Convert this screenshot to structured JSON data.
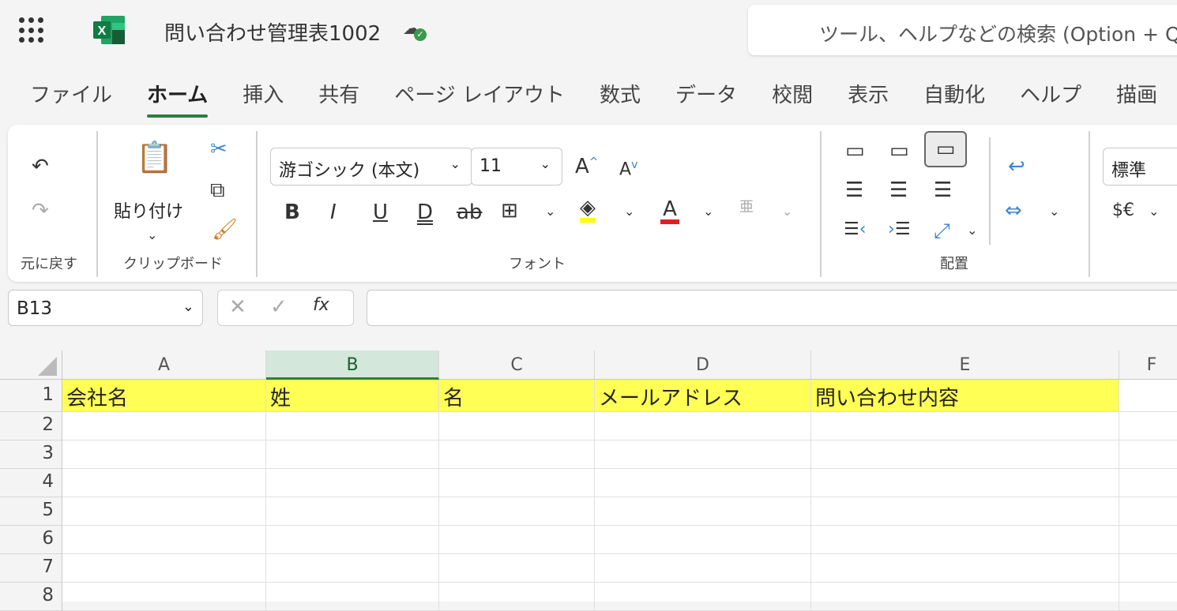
{
  "app": {
    "title": "問い合わせ管理表1002",
    "search_placeholder": "ツール、ヘルプなどの検索 (Option + Q)"
  },
  "tabs": [
    "ファイル",
    "ホーム",
    "挿入",
    "共有",
    "ページ レイアウト",
    "数式",
    "データ",
    "校閲",
    "表示",
    "自動化",
    "ヘルプ",
    "描画"
  ],
  "active_tab": "ホーム",
  "ribbon": {
    "undo_group": "元に戻す",
    "clipboard_group": "クリップボード",
    "paste_label": "貼り付け",
    "font_group": "フォント",
    "font_name": "游ゴシック (本文)",
    "font_size": "11",
    "alignment_group": "配置",
    "number_format": "標準",
    "currency": "$€",
    "fill_color": "#ffff00",
    "font_color": "#e02020"
  },
  "formula_bar": {
    "name_box": "B13",
    "fx": "fx",
    "value": ""
  },
  "sheet": {
    "columns": [
      "A",
      "B",
      "C",
      "D",
      "E",
      "F"
    ],
    "selected_column": "B",
    "rows": [
      "1",
      "2",
      "3",
      "4",
      "5",
      "6",
      "7",
      "8"
    ],
    "header_row": [
      "会社名",
      "姓",
      "名",
      "メールアドレス",
      "問い合わせ内容"
    ],
    "header_fill": "#ffff55"
  }
}
